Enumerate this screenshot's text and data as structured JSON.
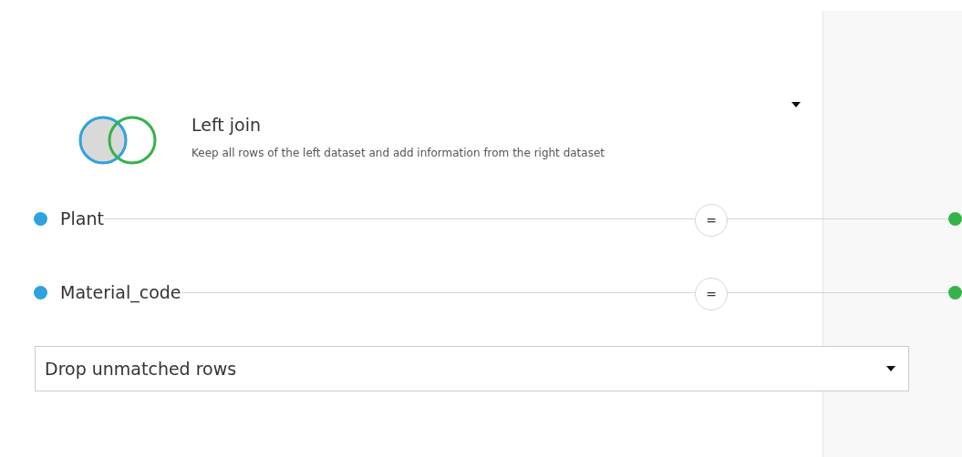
{
  "join_type": {
    "title": "Left join",
    "description": "Keep all rows of the left dataset and add information from the right dataset"
  },
  "conditions": [
    {
      "left_column": "Plant",
      "operator": "="
    },
    {
      "left_column": "Material_code",
      "operator": "="
    }
  ],
  "unmatched_rows": {
    "value": "Drop unmatched rows"
  }
}
